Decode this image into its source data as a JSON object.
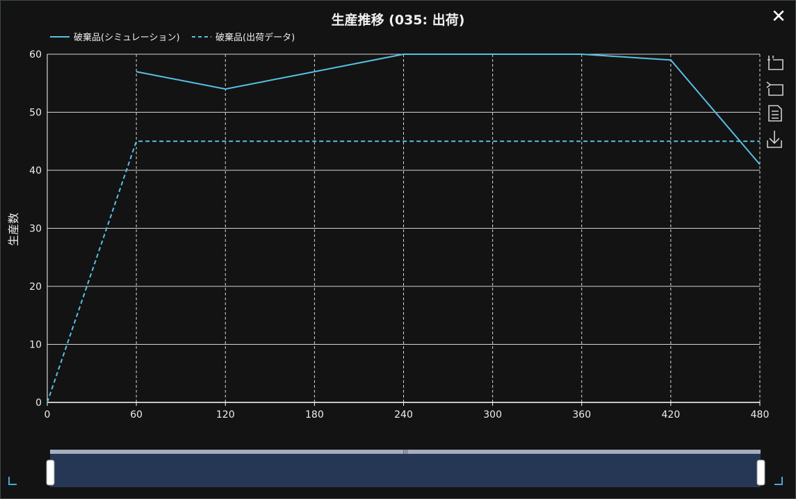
{
  "title": "生産推移 (035: 出荷)",
  "close_label": "✕",
  "legend": {
    "sim_label": "破棄品(シミュレーション)",
    "ship_label": "破棄品(出荷データ)"
  },
  "toolbox": {
    "icons": [
      "zoom-icon",
      "zoom-reset-icon",
      "data-view-icon",
      "save-image-icon"
    ]
  },
  "colors": {
    "series": "#56c2e6",
    "grid": "#d6d6d6",
    "axis": "#ffffff",
    "datazoom": "#253754"
  },
  "chart_data": {
    "type": "line",
    "title": "生産推移 (035: 出荷)",
    "xlabel": "",
    "ylabel": "生産数",
    "xlim": [
      0,
      480
    ],
    "ylim": [
      0,
      60
    ],
    "x_ticks": [
      0,
      60,
      120,
      180,
      240,
      300,
      360,
      420,
      480
    ],
    "y_ticks": [
      0,
      10,
      20,
      30,
      40,
      50,
      60
    ],
    "grid": true,
    "legend_position": "top-left",
    "series": [
      {
        "name": "破棄品(シミュレーション)",
        "style": "solid",
        "points": [
          [
            60,
            57
          ],
          [
            120,
            54
          ],
          [
            180,
            57
          ],
          [
            240,
            60
          ],
          [
            300,
            60
          ],
          [
            360,
            60
          ],
          [
            420,
            59
          ],
          [
            480,
            41
          ]
        ]
      },
      {
        "name": "破棄品(出荷データ)",
        "style": "dashed",
        "points": [
          [
            0,
            0
          ],
          [
            60,
            45
          ],
          [
            120,
            45
          ],
          [
            180,
            45
          ],
          [
            240,
            45
          ],
          [
            300,
            45
          ],
          [
            360,
            45
          ],
          [
            420,
            45
          ],
          [
            480,
            45
          ]
        ]
      }
    ]
  },
  "datazoom": {
    "start_percent": 0,
    "end_percent": 100
  }
}
